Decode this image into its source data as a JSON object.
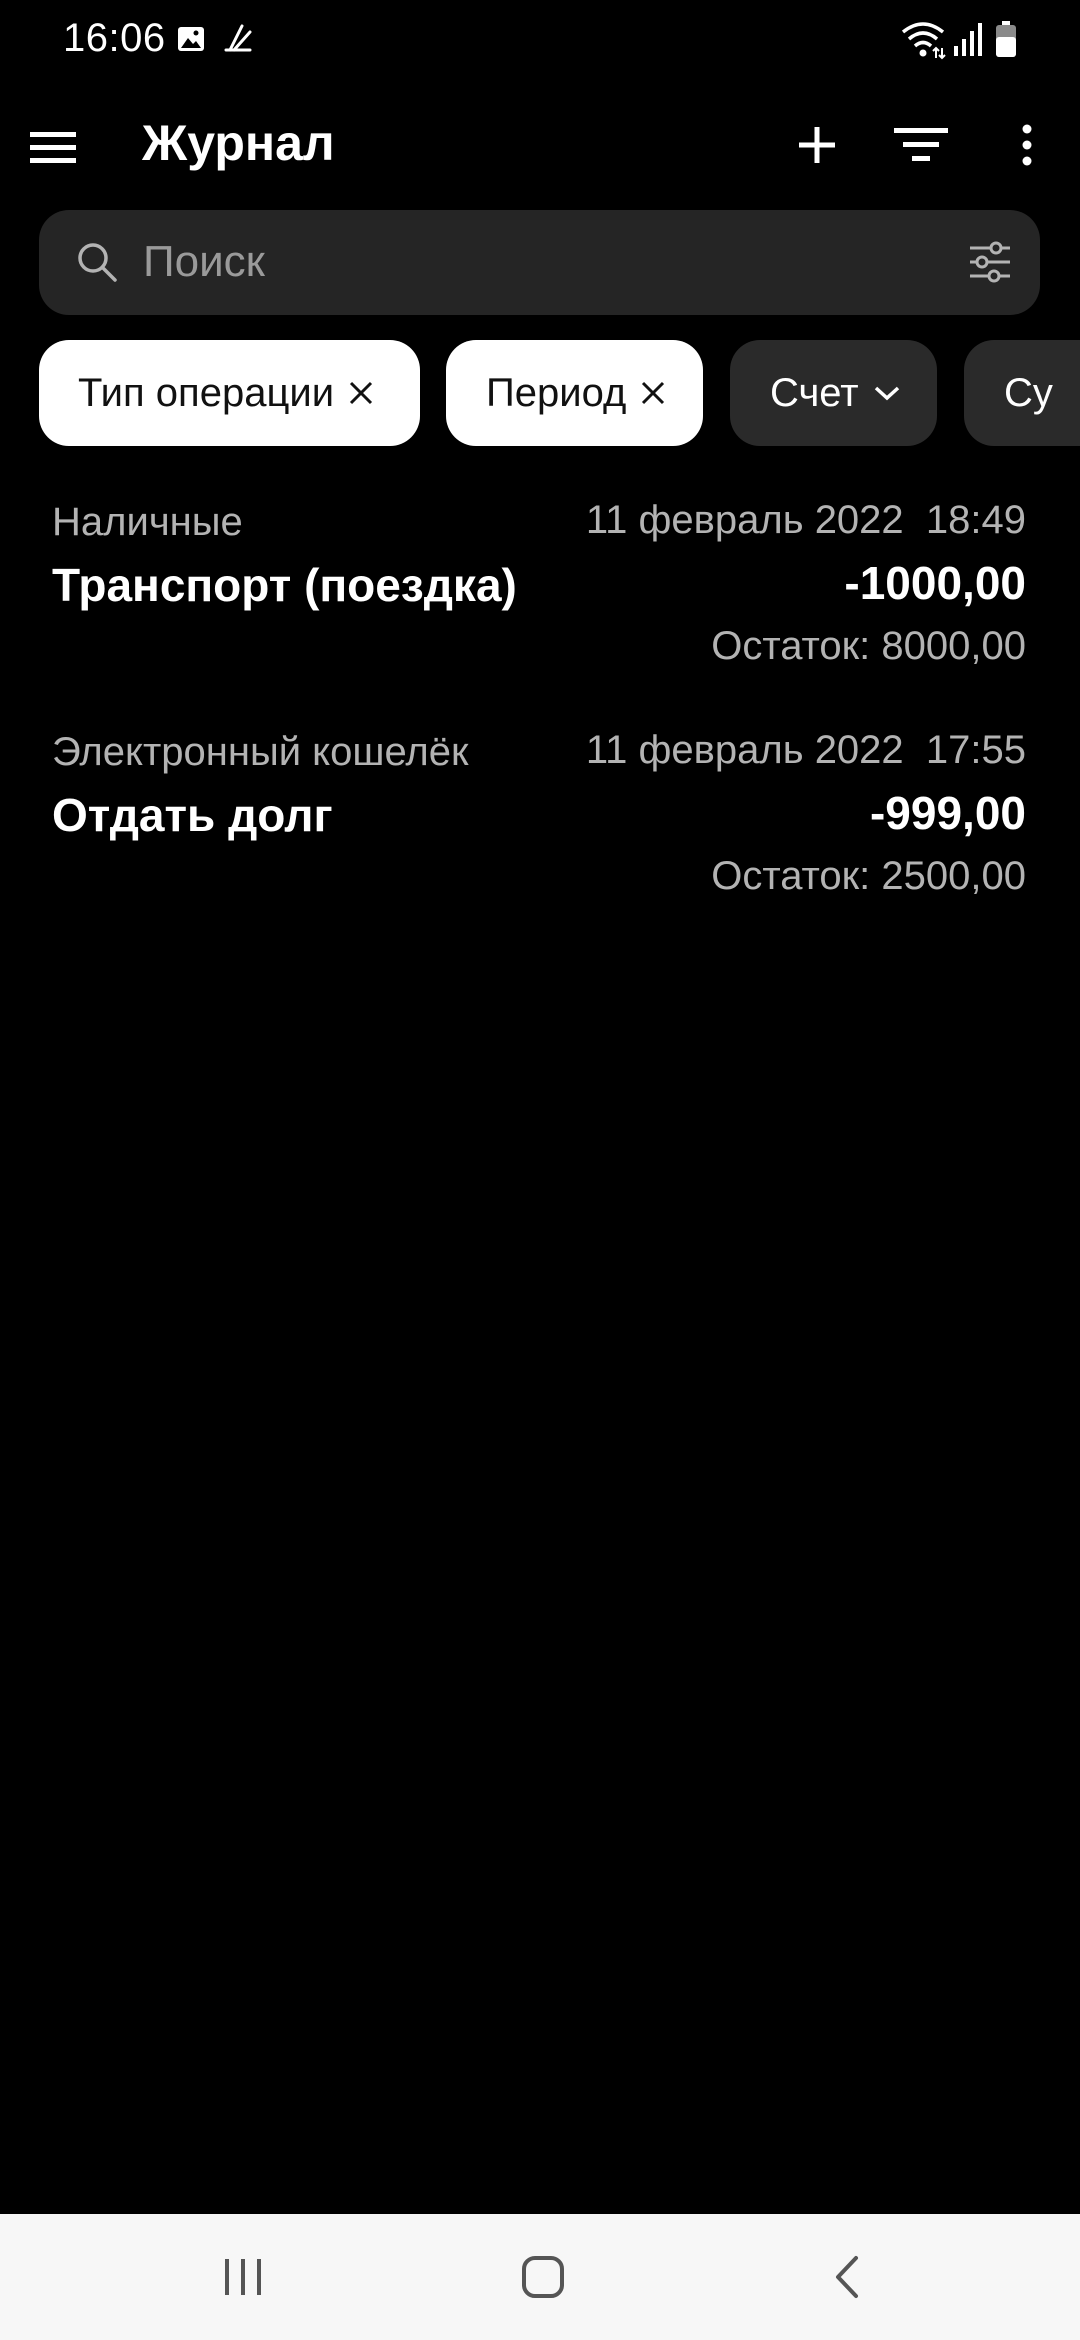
{
  "status_bar": {
    "time": "16:06",
    "icons": [
      "gallery-icon",
      "app-notification-icon",
      "wifi-icon",
      "signal-icon",
      "battery-icon"
    ]
  },
  "app_bar": {
    "title": "Журнал",
    "icons": [
      "hamburger-menu-icon",
      "add-icon",
      "sort-icon",
      "more-vert-icon"
    ]
  },
  "search": {
    "placeholder": "Поиск",
    "value": ""
  },
  "chips": [
    {
      "label": "Тип операции",
      "state": "active",
      "trailing": "close-icon"
    },
    {
      "label": "Период",
      "state": "active",
      "trailing": "close-icon"
    },
    {
      "label": "Счет",
      "state": "inactive",
      "trailing": "chevron-down-icon"
    },
    {
      "label": "Су",
      "state": "inactive",
      "trailing": ""
    }
  ],
  "transactions": [
    {
      "account": "Наличные",
      "datetime": "11 февраль 2022  18:49",
      "category": "Транспорт (поездка)",
      "amount": "-1000,00",
      "balance": "Остаток: 8000,00"
    },
    {
      "account": "Электронный кошелёк",
      "datetime": "11 февраль 2022  17:55",
      "category": "Отдать долг",
      "amount": "-999,00",
      "balance": "Остаток: 2500,00"
    }
  ],
  "nav_bar": {
    "icons": [
      "recents-icon",
      "home-icon",
      "back-icon"
    ]
  },
  "colors": {
    "background": "#000000",
    "search_background": "#252525",
    "chip_active": "#ffffff",
    "chip_inactive": "#2a2a2a",
    "secondary_text": "#b3b3b3",
    "nav_bar": "#f7f7f7"
  }
}
